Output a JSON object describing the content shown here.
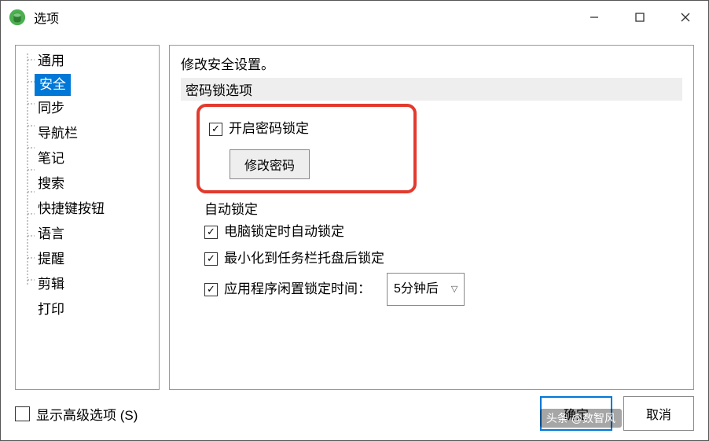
{
  "window": {
    "title": "选项"
  },
  "sidebar": {
    "items": [
      {
        "label": "通用"
      },
      {
        "label": "安全",
        "selected": true
      },
      {
        "label": "同步"
      },
      {
        "label": "导航栏"
      },
      {
        "label": "笔记"
      },
      {
        "label": "搜索"
      },
      {
        "label": "快捷键按钮"
      },
      {
        "label": "语言"
      },
      {
        "label": "提醒"
      },
      {
        "label": "剪辑"
      },
      {
        "label": "打印"
      }
    ]
  },
  "content": {
    "heading": "修改安全设置。",
    "section_pwlock": "密码锁选项",
    "enable_pwlock": "开启密码锁定",
    "change_pw_btn": "修改密码",
    "autolock_heading": "自动锁定",
    "lock_on_pc_lock": "电脑锁定时自动锁定",
    "lock_on_minimize": "最小化到任务栏托盘后锁定",
    "idle_lock_label": "应用程序闲置锁定时间：",
    "idle_lock_value": "5分钟后"
  },
  "footer": {
    "show_advanced": "显示高级选项 (S)",
    "ok": "确定",
    "cancel": "取消"
  },
  "watermark": "头条 @数智风"
}
